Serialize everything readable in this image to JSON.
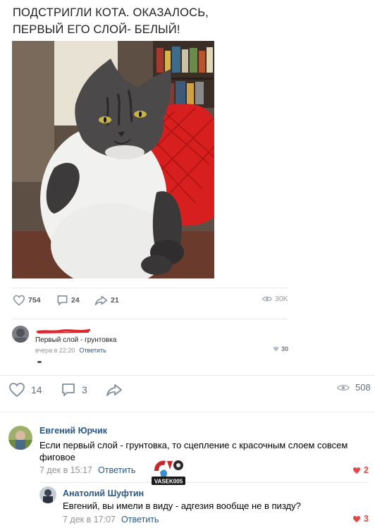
{
  "meme": {
    "caption_line1": "ПОДСТРИГЛИ КОТА. ОКАЗАЛОСЬ,",
    "caption_line2": "ПЕРВЫЙ ЕГО СЛОЙ- БЕЛЫЙ!"
  },
  "inner_post": {
    "likes": "754",
    "comments": "24",
    "shares": "21",
    "views": "30K",
    "comment": {
      "text": "Первый слой - грунтовка",
      "time": "вчера в 22:20",
      "reply_label": "Ответить",
      "likes": "30"
    }
  },
  "post": {
    "likes": "14",
    "comments": "3",
    "views": "508"
  },
  "comments": [
    {
      "author": "Евгений Юрчик",
      "text": "Если первый слой - грунтовка, то сцепление с красочным слоем совсем фиговое",
      "time": "7 дек в 15:17",
      "reply_label": "Ответить",
      "likes": "2"
    },
    {
      "author": "Анатолий Шуфтин",
      "text": "Евгений, вы имели в виду - адгезия вообще не в пизду?",
      "time": "7 дек в 17:07",
      "reply_label": "Ответить",
      "likes": "3"
    }
  ],
  "watermark": {
    "text": "VASEK005"
  },
  "colors": {
    "link": "#2a5885",
    "muted": "#939393",
    "like_red": "#e64646",
    "icon_gray": "#818c99"
  }
}
